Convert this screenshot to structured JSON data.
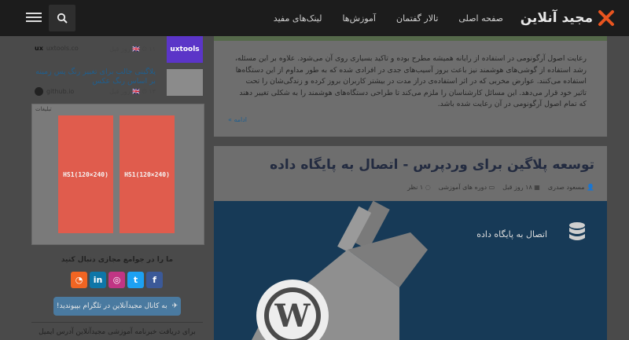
{
  "header": {
    "logo_text": "مجید آنلاین",
    "nav": [
      "صفحه اصلی",
      "تالار گفتمان",
      "آموزش‌ها",
      "لینک‌های مفید"
    ]
  },
  "sidebar": {
    "items": [
      {
        "title": "",
        "meta": "۱۱ روز قبل",
        "source": "uxtools.co",
        "thumb_text": "uxtools"
      },
      {
        "title": "پلاگینی جالب برای تغییر رنگ پس زمینه بر اساس رنگ عکس",
        "meta": "۱۳ روز قبل",
        "source": "github.io",
        "thumb_text": ""
      }
    ],
    "ads_label": "تبلیغات",
    "ads": [
      "HS1(120×240)",
      "HS1(120×240)"
    ],
    "follow_title": "ما را در جوامع مجازی دنبال کنید",
    "socials": [
      {
        "name": "facebook",
        "glyph": "f",
        "color": "#3b5998"
      },
      {
        "name": "twitter",
        "glyph": "t",
        "color": "#1da1f2"
      },
      {
        "name": "instagram",
        "glyph": "◎",
        "color": "#c13584"
      },
      {
        "name": "linkedin",
        "glyph": "in",
        "color": "#0e76a8"
      },
      {
        "name": "rss",
        "glyph": "◔",
        "color": "#f26522"
      }
    ],
    "telegram_label": "به کانال مجیدآنلاین در تلگرام بپیوندید!",
    "newsletter_text": "برای دریافت خبرنامه آموزشی مجیدآنلاین آدرس ایمیل"
  },
  "prev_post": {
    "excerpt": "رعایت اصول آرگونومی در استفاده از رایانه همیشه مطرح بوده و تاکید بسیاری روی آن می‌شود. علاوه بر این مسئله، رشد استفاده از گوشی‌های هوشمند نیز باعث بروز آسیب‌های جدی در افرادی شده که به طور مداوم از این دستگاه‌ها استفاده می‌کنند. عوارض مخربی که در اثر استفاده‌ی دراز مدت در بیشتر کاربران بروز کرده و زندگی‌شان را تحت تاثیر خود قرار می‌دهد. این مسائل کارشناسان را ملزم می‌کند تا طراحی دستگاه‌های هوشمند را به شکلی تغییر دهند که تمام اصول آرگونومی در آن رعایت شده باشد.",
    "more_label": "ادامه »"
  },
  "post": {
    "title": "توسعه پلاگین برای وردپرس - اتصال به پایگاه داده",
    "author": "مسعود صدری",
    "date": "۱۸ روز قبل",
    "category": "دوره های آموزشی",
    "comments": "۱ نظر",
    "hero_label": "اتصال به پایگاه داده"
  }
}
